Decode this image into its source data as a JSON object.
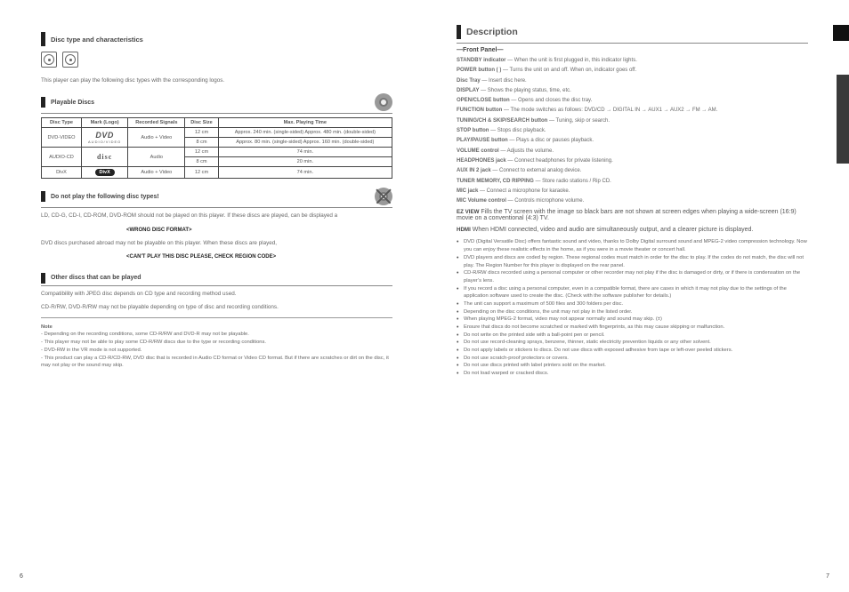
{
  "left": {
    "title": "Disc type and characteristics",
    "playable_header": "Playable Discs",
    "table": {
      "headers": [
        "Disc Type",
        "Mark (Logo)",
        "Recorded Signals",
        "Disc Size",
        "Max. Playing Time"
      ],
      "rows": [
        {
          "type": "DVD-VIDEO",
          "logo": "dvd",
          "signal": "Audio + Video",
          "sizes": [
            {
              "s": "12 cm",
              "t": "Approx. 240 min. (single-sided) Approx. 480 min. (double-sided)"
            },
            {
              "s": "8 cm",
              "t": "Approx. 80 min. (single-sided) Approx. 160 min. (double-sided)"
            }
          ]
        },
        {
          "type": "AUDIO-CD",
          "logo": "cd",
          "signal": "Audio",
          "sizes": [
            {
              "s": "12 cm",
              "t": "74 min."
            },
            {
              "s": "8 cm",
              "t": "20 min."
            }
          ]
        },
        {
          "type": "DivX",
          "logo": "divx",
          "signal": "Audio + Video",
          "sizes": [
            {
              "s": "12 cm",
              "t": "74 min."
            }
          ]
        }
      ]
    },
    "notplay_header": "Do not play the following disc types!",
    "notplay_intro1": "LD, CD-G, CD-I, CD-ROM, DVD-ROM should not be played on this player. If these discs are played, can be displayed a ",
    "warn1": "<WRONG DISC FORMAT>",
    "notplay_intro2": "DVD discs purchased abroad may not be playable on this player. When these discs are played,",
    "warn2": "<CAN'T PLAY THIS DISC PLEASE, CHECK REGION CODE>",
    "other_header": "Other discs that can be played",
    "other_body1": "Compatibility with JPEG disc depends on CD type and recording method used.",
    "other_body2": "CD-R/RW, DVD-R/RW may not be playable depending on type of disc and recording conditions.",
    "note_head": "Note",
    "notes": [
      "Depending on the recording conditions, some CD-R/RW and DVD-R may not be playable.",
      "This player may not be able to play some CD-R/RW discs due to the type or recording conditions.",
      "DVD-RW in the VR mode is not supported.",
      "This product can play a CD-R/CD-RW, DVD disc that is recorded in Audio CD format or Video CD format. But if there are scratches or dirt on the disc, it may not play or the sound may skip."
    ]
  },
  "right": {
    "title": "Description",
    "front": {
      "heading": "—Front Panel—",
      "items": [
        {
          "t": "STANDBY indicator",
          "d": "When the unit is first plugged in, this indicator lights."
        },
        {
          "t": "POWER button ( )",
          "d": "Turns the unit on and off. When on, indicator goes off."
        },
        {
          "t": "Disc Tray",
          "d": "Insert disc here."
        },
        {
          "t": "DISPLAY",
          "d": "Shows the playing status, time, etc."
        },
        {
          "t": "OPEN/CLOSE button",
          "d": "Opens and closes the disc tray."
        },
        {
          "t": "FUNCTION button",
          "d": "The mode switches as follows: DVD/CD → DIGITAL IN → AUX1 → AUX2 → FM → AM."
        },
        {
          "t": "TUNING/CH & SKIP/SEARCH button",
          "d": "Tuning, skip or search."
        },
        {
          "t": "STOP button",
          "d": "Stops disc playback."
        },
        {
          "t": "PLAY/PAUSE button",
          "d": "Plays a disc or pauses playback."
        },
        {
          "t": "VOLUME control",
          "d": "Adjusts the volume."
        },
        {
          "t": "HEADPHONES jack",
          "d": "Connect headphones for private listening."
        },
        {
          "t": "AUX IN 2 jack",
          "d": "Connect to external analog device."
        },
        {
          "t": "TUNER MEMORY, CD RIPPING",
          "d": "Store radio stations / Rip CD."
        },
        {
          "t": "MIC jack",
          "d": "Connect a microphone for karaoke."
        },
        {
          "t": "MIC Volume control",
          "d": "Controls microphone volume."
        }
      ]
    },
    "eztitle": "EZ VIEW",
    "ezbody": "Fills the TV screen with the image so black bars are not shown at screen edges when playing a wide-screen (16:9) movie on a conventional (4:3) TV.",
    "hdmititle": "HDMI",
    "hdmibody": "When HDMI connected, video and audio are simultaneously output, and a clearer picture is displayed.",
    "disc_bullets": [
      "DVD (Digital Versatile Disc) offers fantastic sound and video, thanks to Dolby Digital surround sound and MPEG-2 video compression technology. Now you can enjoy these realistic effects in the home, as if you were in a movie theater or concert hall.",
      "DVD players and discs are coded by region. These regional codes must match in order for the disc to play. If the codes do not match, the disc will not play. The Region Number for this player is displayed on the rear panel.",
      "CD-R/RW discs recorded using a personal computer or other recorder may not play if the disc is damaged or dirty, or if there is condensation on the player’s lens.",
      "If you record a disc using a personal computer, even in a compatible format, there are cases in which it may not play due to the settings of the application software used to create the disc. (Check with the software publisher for details.)",
      "The unit can support a maximum of 500 files and 300 folders per disc.",
      "Depending on the disc conditions, the unit may not play in the listed order.",
      "When playing MPEG-2 format, video may not appear normally and sound may skip. (±)",
      "Ensure that discs do not become scratched or marked with fingerprints, as this may cause skipping or malfunction.",
      "Do not write on the printed side with a ball-point pen or pencil.",
      "Do not use record-cleaning sprays, benzene, thinner, static electricity prevention liquids or any other solvent.",
      "Do not apply labels or stickers to discs. Do not use discs with exposed adhesive from tape or left-over peeled stickers.",
      "Do not use scratch-proof protectors or covers.",
      "Do not use discs printed with label printers sold on the market.",
      "Do not load warped or cracked discs."
    ]
  },
  "pages": {
    "left": "6",
    "right": "7"
  }
}
